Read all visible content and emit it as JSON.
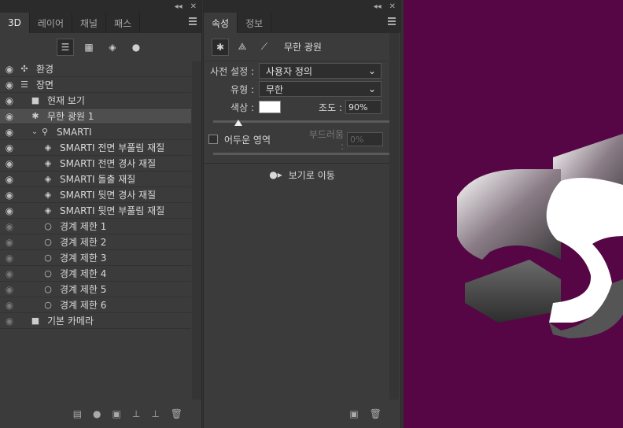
{
  "left_panel": {
    "tabs": [
      "3D",
      "레이어",
      "채널",
      "패스"
    ],
    "toolbar_icons": [
      "scene-filter-icon",
      "mesh-filter-icon",
      "material-filter-icon",
      "light-filter-icon"
    ],
    "rows": [
      {
        "label": "환경",
        "icon": "environment-icon",
        "eye": true,
        "indent": 0
      },
      {
        "label": "장면",
        "icon": "scene-icon",
        "eye": true,
        "indent": 0
      },
      {
        "label": "현재 보기",
        "icon": "camera-icon",
        "eye": true,
        "indent": 1
      },
      {
        "label": "무한 광원 1",
        "icon": "infinite-light-icon",
        "eye": true,
        "indent": 1,
        "selected": true
      },
      {
        "label": "SMARTI",
        "icon": "mesh-icon",
        "eye": true,
        "indent": 1,
        "caret": true
      },
      {
        "label": "SMARTI 전면 부풀림 재질",
        "icon": "material-icon",
        "eye": true,
        "indent": 2
      },
      {
        "label": "SMARTI 전면 경사 재질",
        "icon": "material-icon",
        "eye": true,
        "indent": 2
      },
      {
        "label": "SMARTI 돌출 재질",
        "icon": "material-icon",
        "eye": true,
        "indent": 2
      },
      {
        "label": "SMARTI 뒷면 경사 재질",
        "icon": "material-icon",
        "eye": true,
        "indent": 2
      },
      {
        "label": "SMARTI 뒷면 부풀림 재질",
        "icon": "material-icon",
        "eye": true,
        "indent": 2
      },
      {
        "label": "경계 제한 1",
        "icon": "constraint-icon",
        "eye": false,
        "indent": 2
      },
      {
        "label": "경계 제한 2",
        "icon": "constraint-icon",
        "eye": false,
        "indent": 2
      },
      {
        "label": "경계 제한 3",
        "icon": "constraint-icon",
        "eye": false,
        "indent": 2
      },
      {
        "label": "경계 제한 4",
        "icon": "constraint-icon",
        "eye": false,
        "indent": 2
      },
      {
        "label": "경계 제한 5",
        "icon": "constraint-icon",
        "eye": false,
        "indent": 2
      },
      {
        "label": "경계 제한 6",
        "icon": "constraint-icon",
        "eye": false,
        "indent": 2
      },
      {
        "label": "기본 카메라",
        "icon": "camera-icon",
        "eye": false,
        "indent": 1
      }
    ]
  },
  "props_panel": {
    "tabs": [
      "속성",
      "정보"
    ],
    "title": "무한 광원",
    "preset_label": "사전 설정 :",
    "preset_value": "사용자 정의",
    "type_label": "유형 :",
    "type_value": "무한",
    "color_label": "색상 :",
    "intensity_label": "조도 :",
    "intensity_value": "90%",
    "shadow_label": "어두운 영역",
    "softness_label": "부드러움 :",
    "softness_value": "0%",
    "goto_view": "보기로 이동",
    "slider_fraction": 0.14
  },
  "colors": {
    "canvas_bg": "#560645",
    "light_color": "#ffffff"
  }
}
